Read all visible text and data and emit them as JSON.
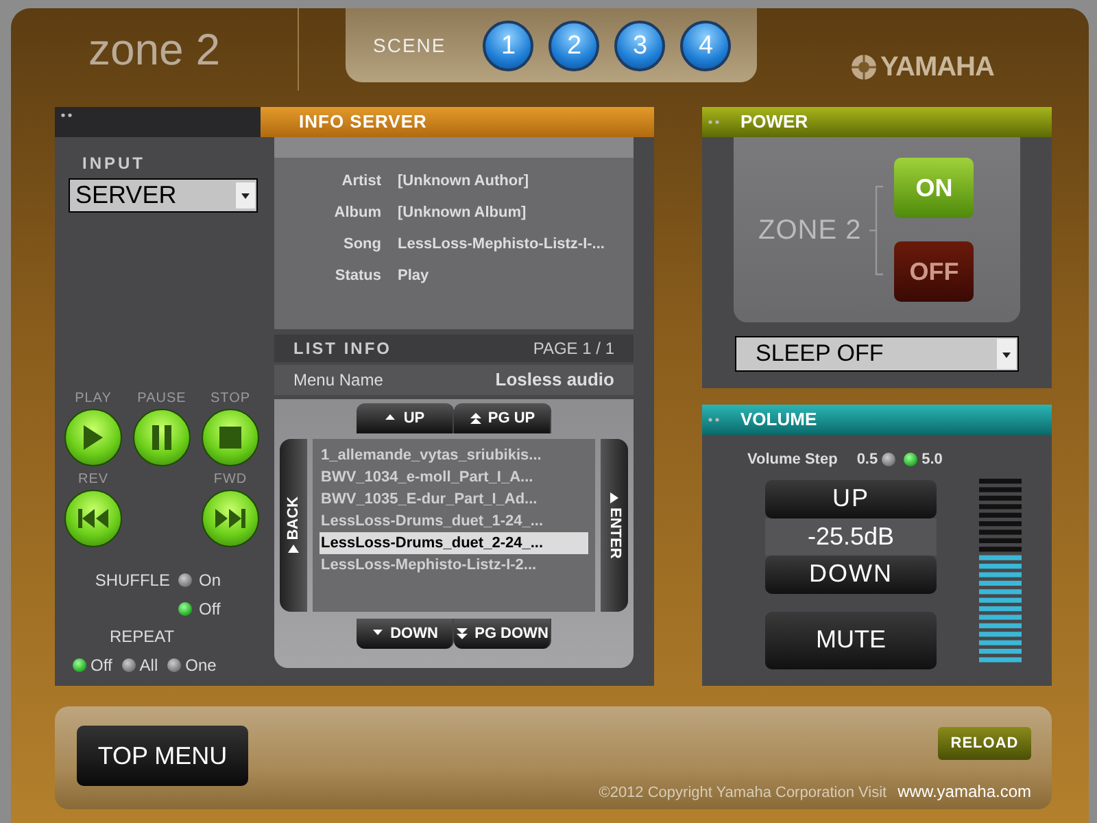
{
  "header": {
    "title": "zone 2",
    "scene_label": "SCENE",
    "scenes": [
      "1",
      "2",
      "3",
      "4"
    ],
    "brand": "YAMAHA"
  },
  "input": {
    "label": "INPUT",
    "value": "SERVER"
  },
  "transport": [
    {
      "label": "PLAY",
      "kind": "play"
    },
    {
      "label": "PAUSE",
      "kind": "pause"
    },
    {
      "label": "STOP",
      "kind": "stop"
    },
    {
      "label": "REV",
      "kind": "rev"
    },
    {
      "label": "FWD",
      "kind": "fwd"
    }
  ],
  "shuffle": {
    "label": "SHUFFLE",
    "options": [
      {
        "label": "On",
        "selected": false
      },
      {
        "label": "Off",
        "selected": true
      }
    ]
  },
  "repeat": {
    "label": "REPEAT",
    "options": [
      {
        "label": "Off",
        "selected": true
      },
      {
        "label": "All",
        "selected": false
      },
      {
        "label": "One",
        "selected": false
      }
    ]
  },
  "info_server": {
    "title": "INFO SERVER",
    "fields": [
      {
        "label": "Artist",
        "value": "[Unknown Author]"
      },
      {
        "label": "Album",
        "value": "[Unknown Album]"
      },
      {
        "label": "Song",
        "value": "LessLoss-Mephisto-Listz-I-..."
      },
      {
        "label": "Status",
        "value": "Play"
      }
    ]
  },
  "list_info": {
    "title": "LIST INFO",
    "page": "PAGE 1 / 1",
    "menu_name_label": "Menu Name",
    "menu_name": "Losless audio",
    "nav_top": [
      {
        "label": "UP",
        "kind": "up"
      },
      {
        "label": "PG UP",
        "kind": "pgup"
      }
    ],
    "nav_bottom": [
      {
        "label": "DOWN",
        "kind": "down"
      },
      {
        "label": "PG DOWN",
        "kind": "pgdown"
      }
    ],
    "back": "BACK",
    "enter": "ENTER",
    "items": [
      {
        "label": "1_allemande_vytas_sriubikis...",
        "selected": false
      },
      {
        "label": "BWV_1034_e-moll_Part_I_A...",
        "selected": false
      },
      {
        "label": "BWV_1035_E-dur_Part_I_Ad...",
        "selected": false
      },
      {
        "label": "LessLoss-Drums_duet_1-24_...",
        "selected": false
      },
      {
        "label": "LessLoss-Drums_duet_2-24_...",
        "selected": true
      },
      {
        "label": "LessLoss-Mephisto-Listz-I-2...",
        "selected": false
      }
    ]
  },
  "power": {
    "title": "POWER",
    "zone": "ZONE 2",
    "on": "ON",
    "off": "OFF",
    "sleep": "SLEEP OFF"
  },
  "volume": {
    "title": "VOLUME",
    "step_label": "Volume Step",
    "steps": [
      {
        "label": "0.5",
        "selected": false
      },
      {
        "label": "5.0",
        "selected": true
      }
    ],
    "up": "UP",
    "reading": "-25.5dB",
    "down": "DOWN",
    "mute": "MUTE",
    "meter": {
      "level": 0.58
    }
  },
  "footer": {
    "top_menu": "TOP MENU",
    "reload": "RELOAD",
    "copyright": "©2012 Copyright Yamaha Corporation Visit",
    "link": "www.yamaha.com"
  }
}
